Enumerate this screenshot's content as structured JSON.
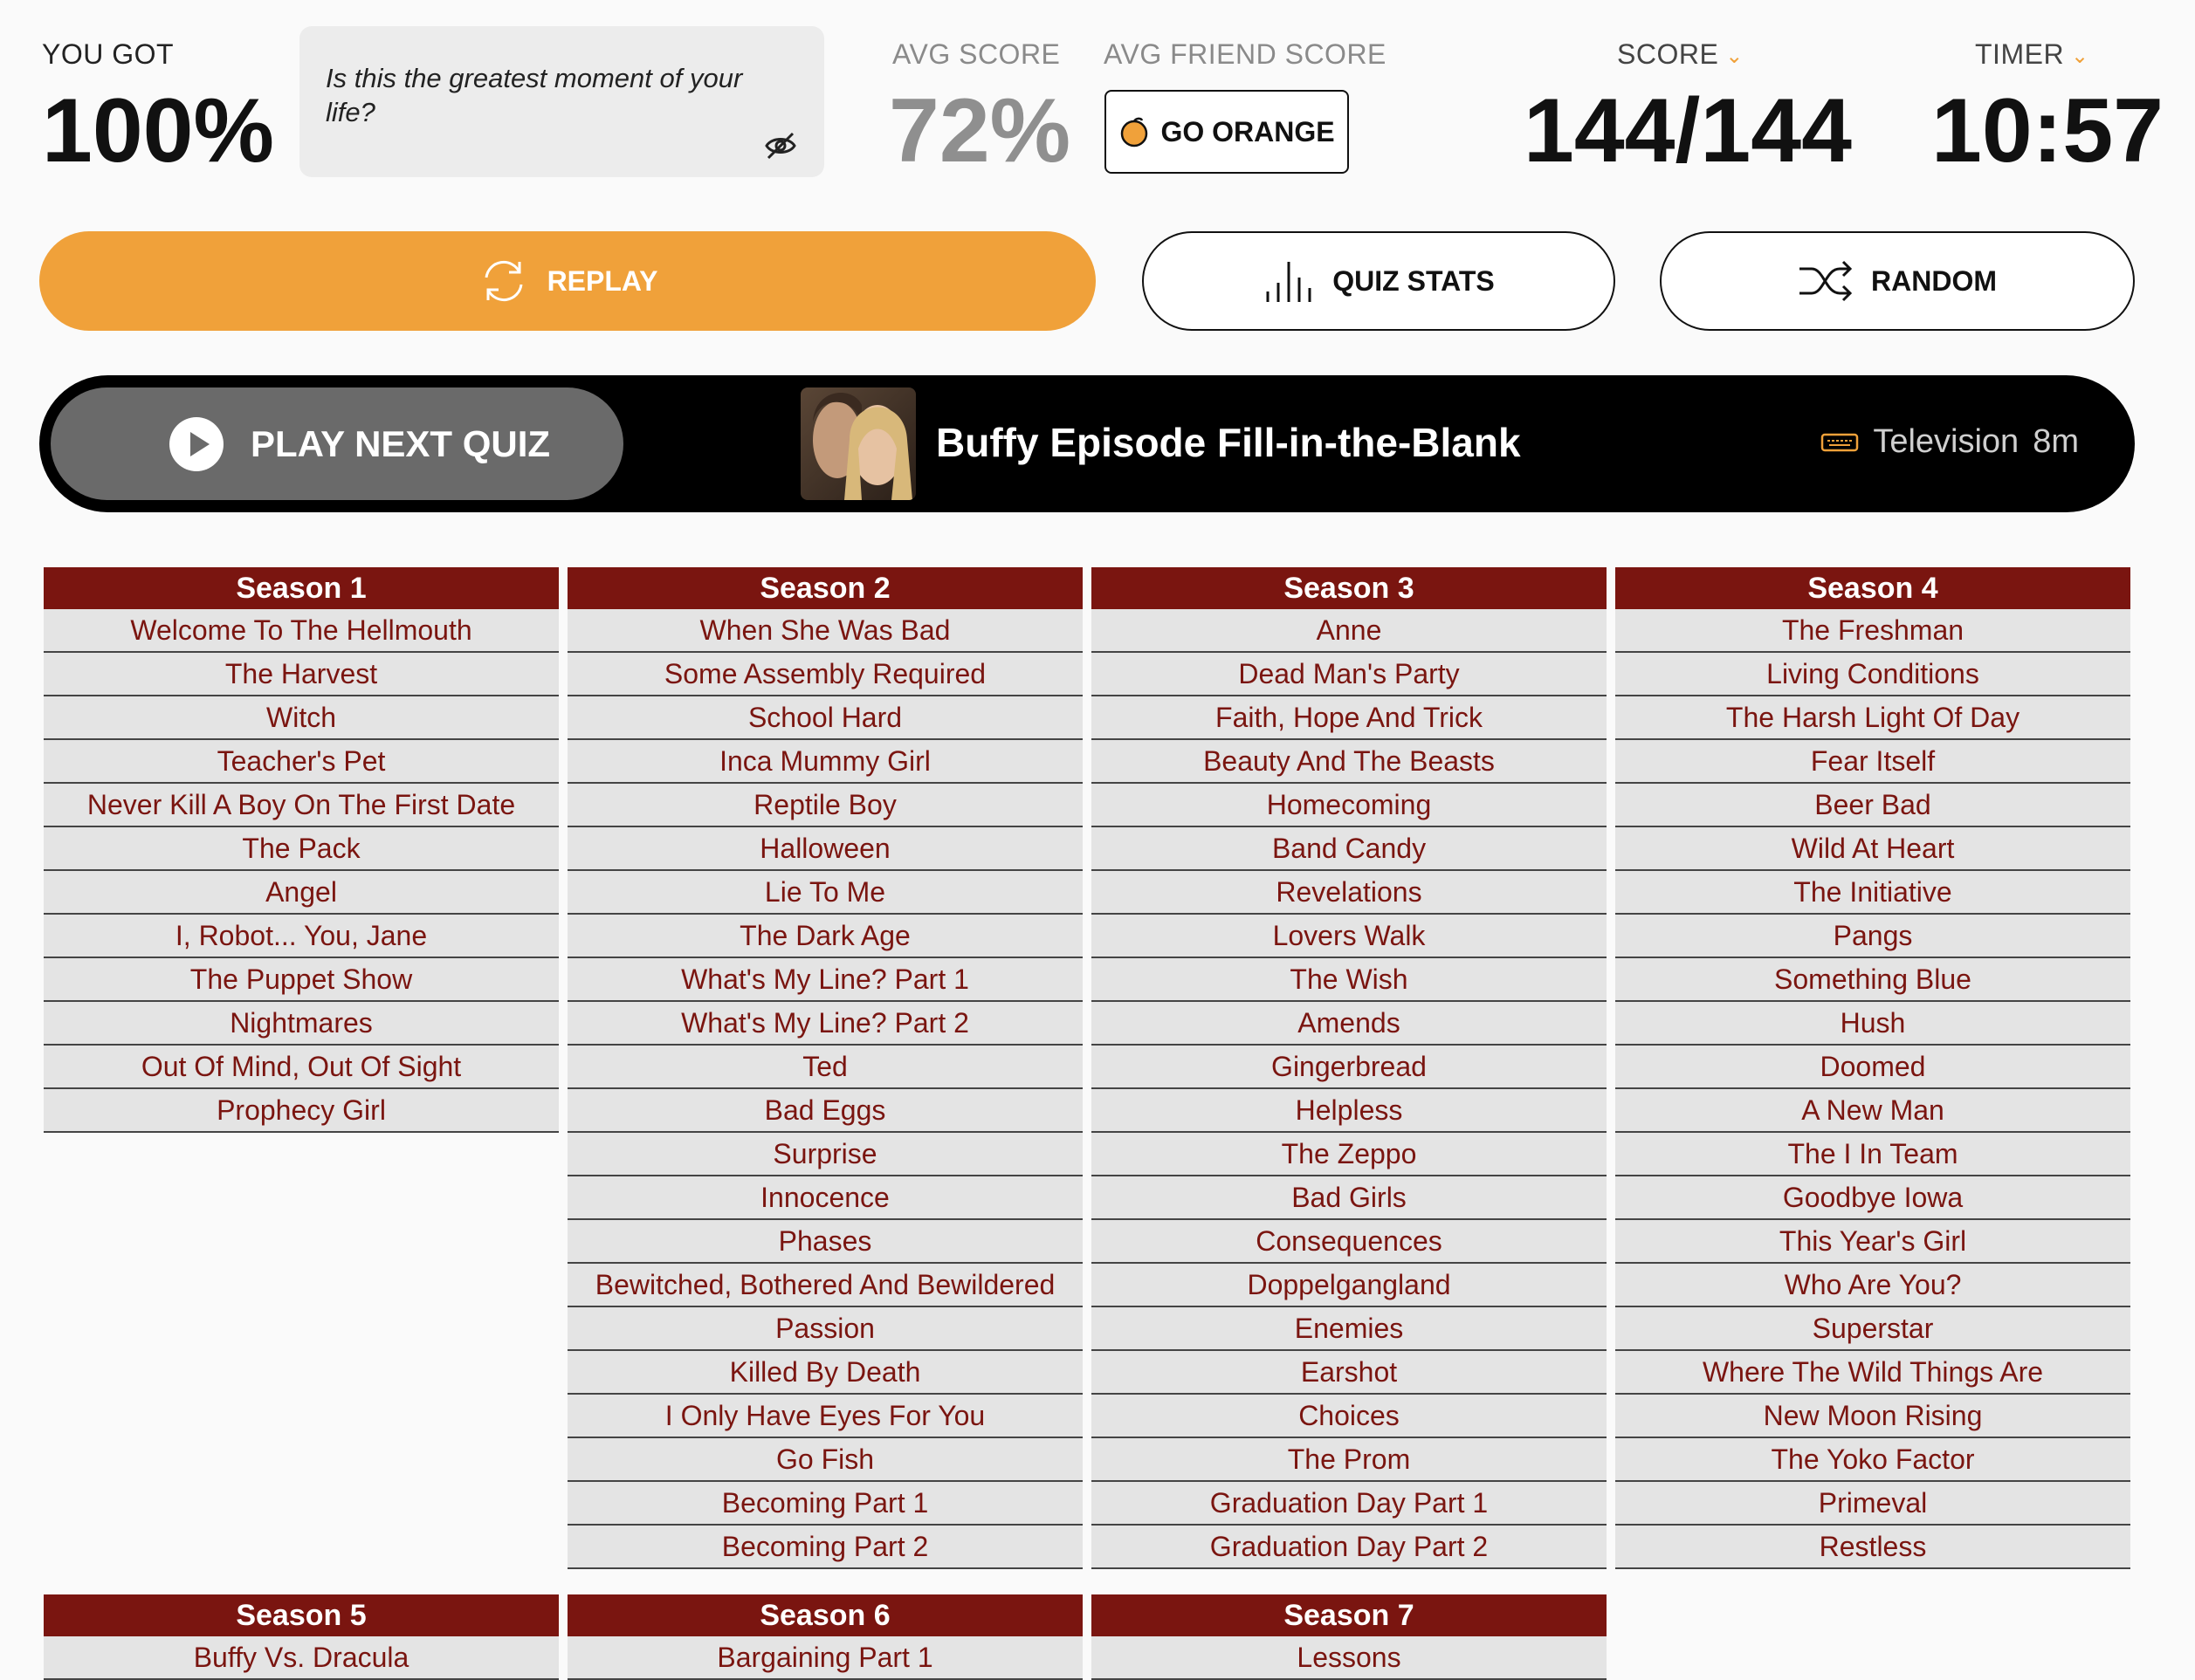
{
  "stats": {
    "you_got_label": "YOU GOT",
    "you_got_value": "100%",
    "quote": "Is this the greatest moment of your life?",
    "avg_score_label": "AVG SCORE",
    "avg_score_value": "72%",
    "avg_friend_label": "AVG FRIEND SCORE",
    "go_orange_label": "GO ORANGE",
    "score_label": "SCORE",
    "score_value": "144/144",
    "timer_label": "TIMER",
    "timer_value": "10:57"
  },
  "actions": {
    "replay": "REPLAY",
    "quiz_stats": "QUIZ STATS",
    "random": "RANDOM"
  },
  "next_quiz": {
    "play_label": "PLAY NEXT QUIZ",
    "title": "Buffy Episode Fill-in-the-Blank",
    "category": "Television",
    "duration": "8m"
  },
  "colors": {
    "accent_orange": "#f0a13a",
    "season_header": "#7a1510",
    "episode_text": "#7a1510",
    "row_bg": "#e4e4e4"
  },
  "seasons": [
    {
      "name": "Season 1",
      "episodes": [
        "Welcome To The Hellmouth",
        "The Harvest",
        "Witch",
        "Teacher's Pet",
        "Never Kill A Boy On The First Date",
        "The Pack",
        "Angel",
        "I, Robot... You, Jane",
        "The Puppet Show",
        "Nightmares",
        "Out Of Mind, Out Of Sight",
        "Prophecy Girl"
      ]
    },
    {
      "name": "Season 2",
      "episodes": [
        "When She Was Bad",
        "Some Assembly Required",
        "School Hard",
        "Inca Mummy Girl",
        "Reptile Boy",
        "Halloween",
        "Lie To Me",
        "The Dark Age",
        "What's My Line? Part 1",
        "What's My Line? Part 2",
        "Ted",
        "Bad Eggs",
        "Surprise",
        "Innocence",
        "Phases",
        "Bewitched, Bothered And Bewildered",
        "Passion",
        "Killed By Death",
        "I Only Have Eyes For You",
        "Go Fish",
        "Becoming Part 1",
        "Becoming Part 2"
      ]
    },
    {
      "name": "Season 3",
      "episodes": [
        "Anne",
        "Dead Man's Party",
        "Faith, Hope And Trick",
        "Beauty And The Beasts",
        "Homecoming",
        "Band Candy",
        "Revelations",
        "Lovers Walk",
        "The Wish",
        "Amends",
        "Gingerbread",
        "Helpless",
        "The Zeppo",
        "Bad Girls",
        "Consequences",
        "Doppelgangland",
        "Enemies",
        "Earshot",
        "Choices",
        "The Prom",
        "Graduation Day Part 1",
        "Graduation Day Part 2"
      ]
    },
    {
      "name": "Season 4",
      "episodes": [
        "The Freshman",
        "Living Conditions",
        "The Harsh Light Of Day",
        "Fear Itself",
        "Beer Bad",
        "Wild At Heart",
        "The Initiative",
        "Pangs",
        "Something Blue",
        "Hush",
        "Doomed",
        "A New Man",
        "The I In Team",
        "Goodbye Iowa",
        "This Year's Girl",
        "Who Are You?",
        "Superstar",
        "Where The Wild Things Are",
        "New Moon Rising",
        "The Yoko Factor",
        "Primeval",
        "Restless"
      ]
    },
    {
      "name": "Season 5",
      "episodes": [
        "Buffy Vs. Dracula"
      ]
    },
    {
      "name": "Season 6",
      "episodes": [
        "Bargaining Part 1"
      ]
    },
    {
      "name": "Season 7",
      "episodes": [
        "Lessons"
      ]
    }
  ]
}
